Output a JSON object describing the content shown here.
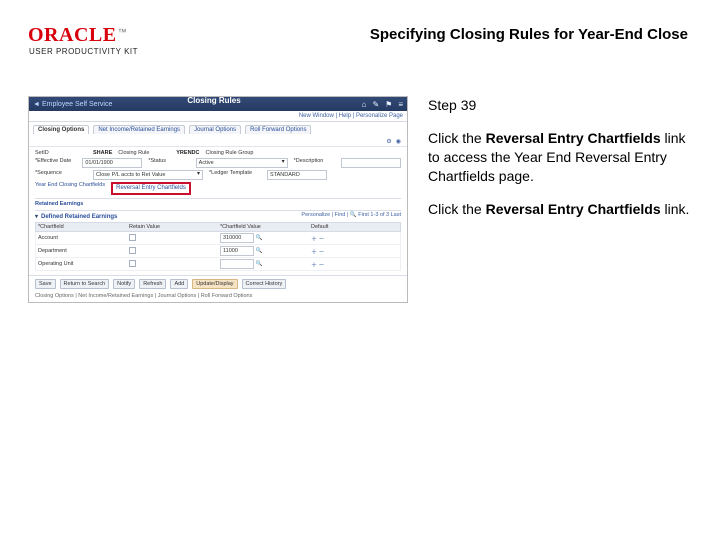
{
  "brand": {
    "name": "ORACLE",
    "tm": "™",
    "sub": "USER PRODUCTIVITY KIT"
  },
  "doc_title": "Specifying Closing Rules for Year-End Close",
  "step_label": "Step 39",
  "instruction_intro": "Click the ",
  "instruction_link": "Reversal Entry Chartfields",
  "instruction_rest": " link to access the Year End Reversal Entry Chartfields page.",
  "action_intro": "Click the ",
  "action_link": "Reversal Entry Chartfields",
  "action_rest": " link.",
  "shot": {
    "back": "Employee Self Service",
    "title": "Closing Rules",
    "icons": [
      "home",
      "wrench",
      "flag",
      "menu"
    ],
    "crumb_right": "New Window | Help | Personalize Page",
    "tabs": [
      "Closing Options",
      "Net Income/Retained Earnings",
      "Journal Options",
      "Roll Forward Options"
    ],
    "util": [
      "⚙",
      "◉"
    ],
    "rows": [
      {
        "lbl": "SetID",
        "val": "SHARE",
        "lbl2": "Closing Rule",
        "val2": "YRENDC",
        "lbl3": "Closing Rule Group",
        "val3": ""
      },
      {
        "lbl": "*Effective Date",
        "val": "01/01/1900",
        "lbl2": "*Status",
        "sel": "Active",
        "lbl3": "*Description",
        "in": ""
      },
      {
        "lbl": "*Sequence",
        "sel": "Close P/L accts to Ret Value",
        "lbl2": "*Ledger Template",
        "in": "STANDARD"
      }
    ],
    "links": {
      "ye_closing": "Year End Closing Chartfields",
      "reversal": "Reversal Entry Chartfields"
    },
    "section2": "Retained Earnings",
    "section3": "Defined Retained Earnings",
    "grid_tools": "Personalize | Find | 🔍   First 1-3 of 3 Last",
    "grid_headers": [
      "*Chartfield",
      "Retain Value",
      "*Chartfield Value",
      "Default"
    ],
    "grid_rows": [
      {
        "cf": "Account",
        "in": "310000"
      },
      {
        "cf": "Department",
        "in": "11000"
      },
      {
        "cf": "Operating Unit",
        "in": ""
      }
    ],
    "actions": {
      "save": "Save",
      "ret": "Return to Search",
      "notify": "Notify",
      "refresh": "Refresh",
      "add": "Add",
      "upd": "Update/Display",
      "corr": "Correct History"
    },
    "footer_tabs": "Closing Options | Net Income/Retained Earnings | Journal Options | Roll Forward Options"
  }
}
